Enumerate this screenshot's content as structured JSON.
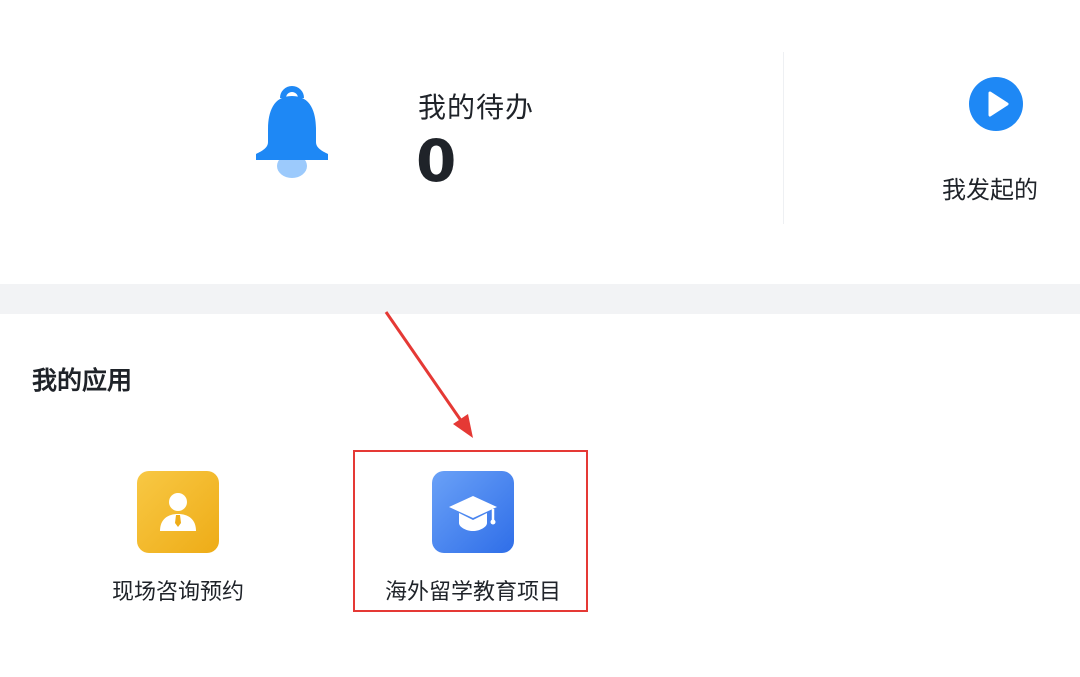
{
  "summary": {
    "todo_title": "我的待办",
    "todo_count": "0",
    "initiated_label": "我发起的"
  },
  "apps": {
    "section_title": "我的应用",
    "items": [
      {
        "label": "现场咨询预约",
        "icon": "consultant-icon",
        "color": "#f2b526"
      },
      {
        "label": "海外留学教育项目",
        "icon": "graduation-cap-icon",
        "color": "#3f7ff0"
      }
    ]
  },
  "annotation": {
    "highlight_color": "#e53935"
  },
  "colors": {
    "accent": "#1e88f5",
    "text": "#1f2329",
    "gap": "#f2f3f5"
  }
}
